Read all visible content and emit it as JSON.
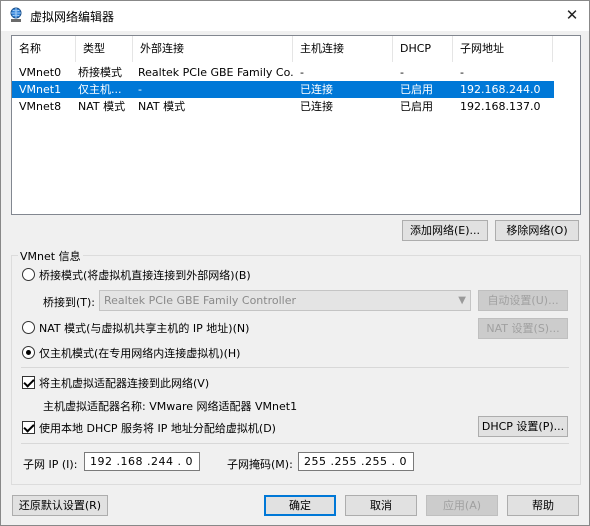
{
  "window": {
    "title": "虚拟网络编辑器",
    "close": "✕"
  },
  "list": {
    "headers": [
      "名称",
      "类型",
      "外部连接",
      "主机连接",
      "DHCP",
      "子网地址"
    ],
    "rows": [
      [
        "VMnet0",
        "桥接模式",
        "Realtek PCIe GBE Family Co...",
        "-",
        "-",
        "-"
      ],
      [
        "VMnet1",
        "仅主机...",
        "-",
        "已连接",
        "已启用",
        "192.168.244.0"
      ],
      [
        "VMnet8",
        "NAT 模式",
        "NAT 模式",
        "已连接",
        "已启用",
        "192.168.137.0"
      ]
    ],
    "selected_row": 1
  },
  "buttons": {
    "add_network": "添加网络(E)...",
    "remove_network": "移除网络(O)",
    "auto_settings": "自动设置(U)...",
    "nat_settings": "NAT 设置(S)...",
    "dhcp_settings": "DHCP 设置(P)...",
    "restore_defaults": "还原默认设置(R)",
    "ok": "确定",
    "cancel": "取消",
    "apply": "应用(A)",
    "help": "帮助"
  },
  "vmnet_info": {
    "group_label": "VMnet 信息",
    "bridge_radio": "桥接模式(将虚拟机直接连接到外部网络)(B)",
    "bridge_to_label": "桥接到(T):",
    "bridge_to_value": "Realtek PCIe GBE Family Controller",
    "nat_radio": "NAT 模式(与虚拟机共享主机的 IP 地址)(N)",
    "host_only_radio": "仅主机模式(在专用网络内连接虚拟机)(H)",
    "selected_mode": "host_only",
    "connect_adapter_check": "将主机虚拟适配器连接到此网络(V)",
    "adapter_name_label": "主机虚拟适配器名称: VMware 网络适配器 VMnet1",
    "dhcp_check": "使用本地 DHCP 服务将 IP 地址分配给虚拟机(D)",
    "subnet_ip_label": "子网 IP (I):",
    "subnet_ip_value": "192 .168 .244 . 0",
    "subnet_mask_label": "子网掩码(M):",
    "subnet_mask_value": "255 .255 .255 . 0"
  },
  "colors": {
    "selection": "#0078d7",
    "default_button_border": "#0078d7"
  }
}
